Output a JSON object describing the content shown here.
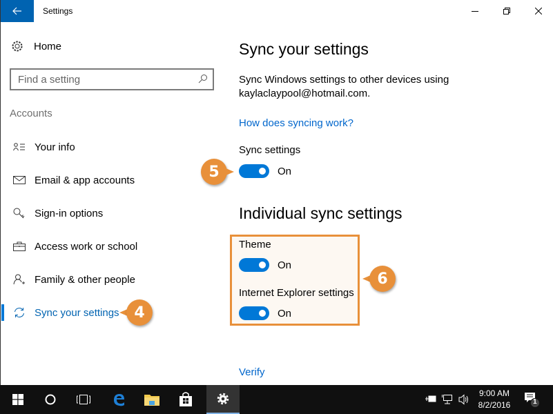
{
  "window": {
    "title": "Settings",
    "controls": {
      "minimize": "minimize",
      "maximize": "restore",
      "close": "close"
    }
  },
  "sidebar": {
    "home_label": "Home",
    "search_placeholder": "Find a setting",
    "section_label": "Accounts",
    "items": [
      {
        "label": "Your info",
        "icon": "contact-info-icon",
        "active": false
      },
      {
        "label": "Email & app accounts",
        "icon": "mail-icon",
        "active": false
      },
      {
        "label": "Sign-in options",
        "icon": "key-icon",
        "active": false
      },
      {
        "label": "Access work or school",
        "icon": "briefcase-icon",
        "active": false
      },
      {
        "label": "Family & other people",
        "icon": "add-person-icon",
        "active": false
      },
      {
        "label": "Sync your settings",
        "icon": "sync-icon",
        "active": true
      }
    ]
  },
  "main": {
    "title": "Sync your settings",
    "description": "Sync Windows settings to other devices using kaylaclaypool@hotmail.com.",
    "help_link": "How does syncing work?",
    "sync_settings": {
      "label": "Sync settings",
      "state": "On",
      "enabled": true
    },
    "individual_title": "Individual sync settings",
    "individual": [
      {
        "label": "Theme",
        "state": "On",
        "enabled": true
      },
      {
        "label": "Internet Explorer settings",
        "state": "On",
        "enabled": true
      }
    ],
    "verify_link": "Verify"
  },
  "callouts": {
    "step4": "4",
    "step5": "5",
    "step6": "6"
  },
  "taskbar": {
    "time": "9:00 AM",
    "date": "8/2/2016",
    "notification_count": "1"
  },
  "colors": {
    "accent": "#0078d7",
    "callout": "#e8903a",
    "link": "#0066cc"
  }
}
